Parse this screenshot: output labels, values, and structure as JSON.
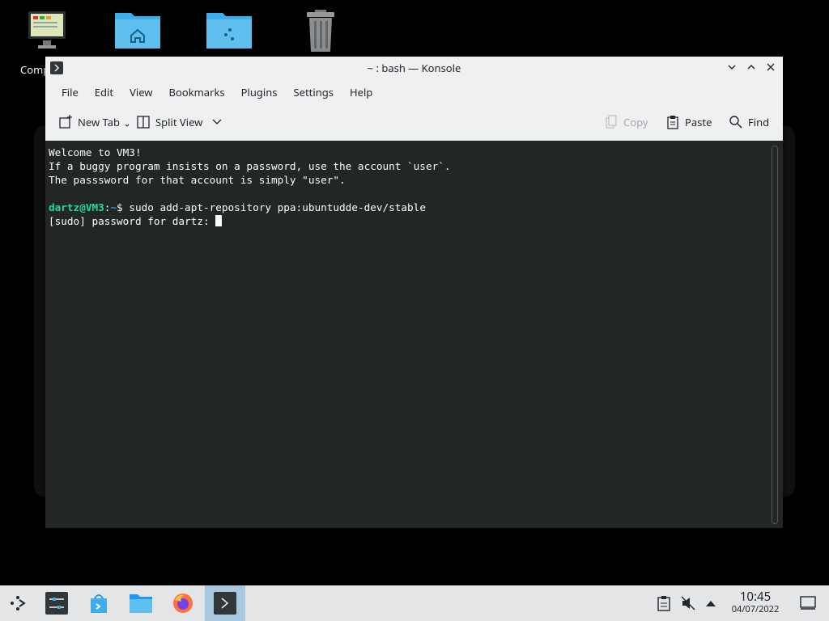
{
  "desktop": {
    "icons": [
      {
        "name": "computer",
        "label": "Comp"
      },
      {
        "name": "home-folder",
        "label": ""
      },
      {
        "name": "network-folder",
        "label": ""
      },
      {
        "name": "trash",
        "label": ""
      }
    ]
  },
  "window": {
    "title": "~ : bash — Konsole",
    "menu": [
      "File",
      "Edit",
      "View",
      "Bookmarks",
      "Plugins",
      "Settings",
      "Help"
    ],
    "toolbar": {
      "new_tab": "New Tab",
      "split_view": "Split View",
      "copy": "Copy",
      "paste": "Paste",
      "find": "Find"
    }
  },
  "terminal": {
    "line1": "Welcome to VM3!",
    "line2": "If a buggy program insists on a password, use the account `user`.",
    "line3": "The passsword for that account is simply \"user\".",
    "prompt_user": "dartz@VM3",
    "prompt_sep": ":",
    "prompt_path": "~",
    "prompt_symbol": "$ ",
    "command": "sudo add-apt-repository ppa:ubuntudde-dev/stable",
    "line5": "[sudo] password for dartz: "
  },
  "taskbar": {
    "time": "10:45",
    "date": "04/07/2022"
  },
  "colors": {
    "terminal_bg": "#232627",
    "prompt_user": "#1cdc9a",
    "prompt_path": "#1d99f3",
    "taskbar_active": "#a8c8e0"
  }
}
